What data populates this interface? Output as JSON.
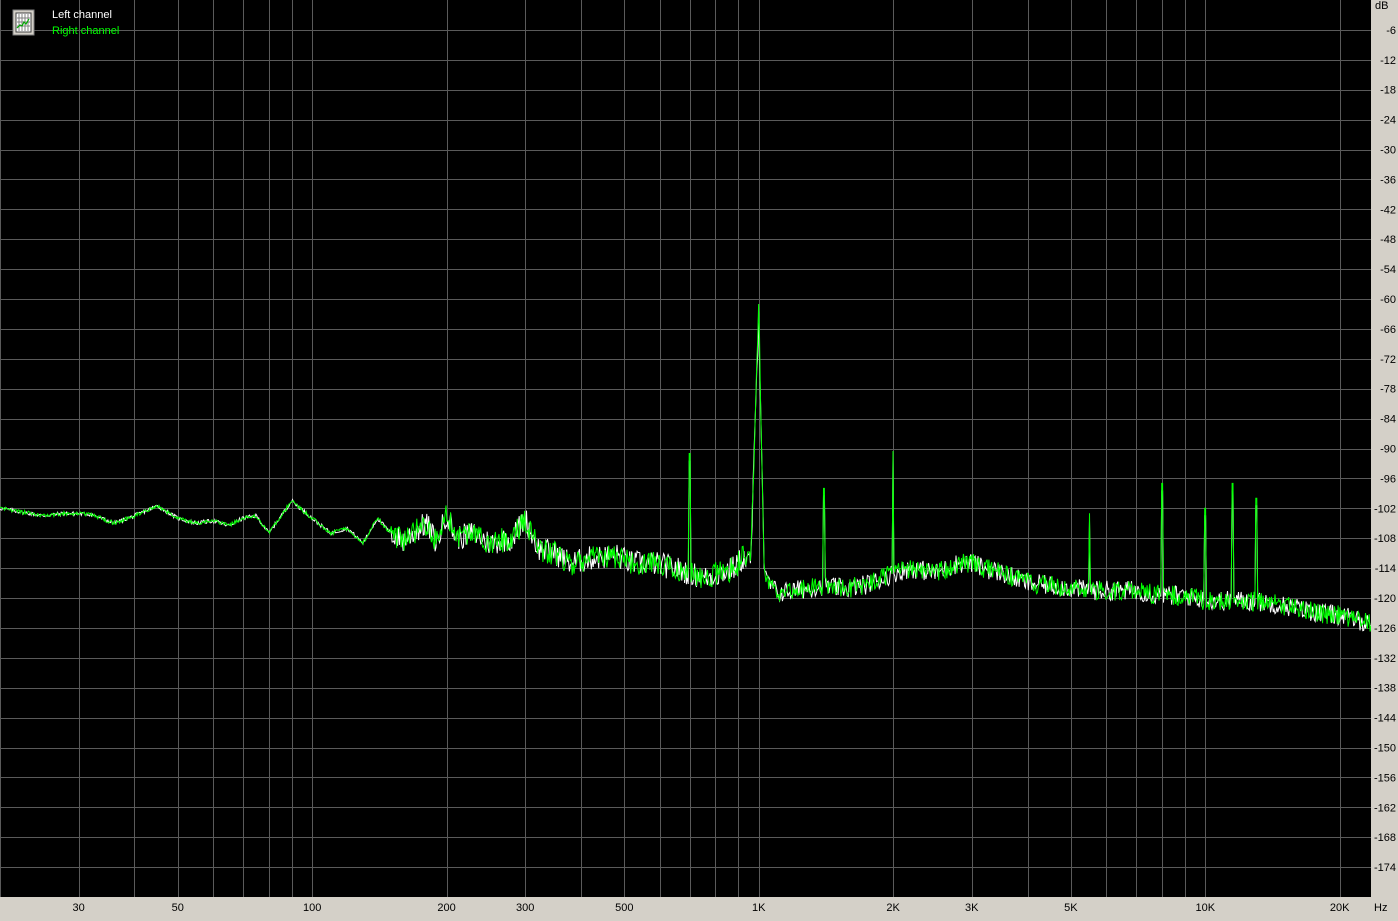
{
  "legend": {
    "icon": "spectrum-legend-icon",
    "items": [
      {
        "label": "Left channel",
        "color": "#ffffff"
      },
      {
        "label": "Right channel",
        "color": "#00ff00"
      }
    ]
  },
  "colors": {
    "background": "#000000",
    "grid": "#5a5a5a",
    "left_channel": "#ffffff",
    "right_channel": "#00ff00",
    "axis_panel": "#d4d0c8"
  },
  "chart_data": {
    "type": "line",
    "xscale": "log",
    "xlim": [
      20,
      23500
    ],
    "ylim": [
      -180,
      0
    ],
    "yunit": "dB",
    "xunit": "Hz",
    "grid": true,
    "legend_position": "top-left",
    "yticks": [
      -6,
      -12,
      -18,
      -24,
      -30,
      -36,
      -42,
      -48,
      -54,
      -60,
      -66,
      -72,
      -78,
      -84,
      -90,
      -96,
      -102,
      -108,
      -114,
      -120,
      -126,
      -132,
      -138,
      -144,
      -150,
      -156,
      -162,
      -168,
      -174
    ],
    "xticks": [
      {
        "value": 30,
        "label": "30"
      },
      {
        "value": 50,
        "label": "50"
      },
      {
        "value": 100,
        "label": "100"
      },
      {
        "value": 200,
        "label": "200"
      },
      {
        "value": 300,
        "label": "300"
      },
      {
        "value": 500,
        "label": "500"
      },
      {
        "value": 1000,
        "label": "1K"
      },
      {
        "value": 2000,
        "label": "2K"
      },
      {
        "value": 3000,
        "label": "3K"
      },
      {
        "value": 5000,
        "label": "5K"
      },
      {
        "value": 10000,
        "label": "10K"
      },
      {
        "value": 20000,
        "label": "20K"
      }
    ],
    "series": [
      {
        "name": "Left channel",
        "color": "#ffffff",
        "points": [
          [
            20,
            -102
          ],
          [
            25,
            -103.5
          ],
          [
            28,
            -103
          ],
          [
            32,
            -103.2
          ],
          [
            36,
            -105
          ],
          [
            40,
            -103.5
          ],
          [
            45,
            -101.5
          ],
          [
            50,
            -104
          ],
          [
            55,
            -105
          ],
          [
            60,
            -104.5
          ],
          [
            65,
            -105.5
          ],
          [
            70,
            -104
          ],
          [
            75,
            -103.5
          ],
          [
            80,
            -107
          ],
          [
            90,
            -100.5
          ],
          [
            100,
            -104
          ],
          [
            110,
            -107
          ],
          [
            120,
            -106
          ],
          [
            130,
            -109
          ],
          [
            140,
            -104
          ],
          [
            150,
            -107
          ],
          [
            160,
            -108.5
          ],
          [
            180,
            -105
          ],
          [
            190,
            -109
          ],
          [
            200,
            -103
          ],
          [
            210,
            -108
          ],
          [
            230,
            -107
          ],
          [
            250,
            -109
          ],
          [
            280,
            -108
          ],
          [
            300,
            -104
          ],
          [
            320,
            -110
          ],
          [
            350,
            -111
          ],
          [
            380,
            -113
          ],
          [
            420,
            -112
          ],
          [
            480,
            -111.5
          ],
          [
            520,
            -113
          ],
          [
            580,
            -113
          ],
          [
            650,
            -114
          ],
          [
            700,
            -115
          ],
          [
            760,
            -116
          ],
          [
            820,
            -115
          ],
          [
            880,
            -114
          ],
          [
            920,
            -112
          ],
          [
            960,
            -113
          ],
          [
            1000,
            -63
          ],
          [
            1030,
            -116
          ],
          [
            1100,
            -119
          ],
          [
            1200,
            -118.5
          ],
          [
            1300,
            -118
          ],
          [
            1400,
            -117.5
          ],
          [
            1500,
            -118
          ],
          [
            1600,
            -118
          ],
          [
            1800,
            -117
          ],
          [
            2000,
            -115
          ],
          [
            2200,
            -114
          ],
          [
            2500,
            -115
          ],
          [
            2800,
            -113
          ],
          [
            3000,
            -113
          ],
          [
            3200,
            -114
          ],
          [
            3500,
            -115
          ],
          [
            4000,
            -117
          ],
          [
            4500,
            -117.5
          ],
          [
            5000,
            -118
          ],
          [
            5500,
            -118.5
          ],
          [
            6000,
            -118.5
          ],
          [
            6500,
            -118.5
          ],
          [
            7000,
            -118.5
          ],
          [
            8000,
            -119.5
          ],
          [
            9000,
            -119.5
          ],
          [
            10000,
            -120.5
          ],
          [
            11000,
            -120.5
          ],
          [
            12000,
            -120.5
          ],
          [
            14000,
            -121
          ],
          [
            16000,
            -122
          ],
          [
            18000,
            -123
          ],
          [
            20000,
            -123.5
          ],
          [
            22000,
            -124.5
          ],
          [
            23500,
            -125
          ]
        ]
      },
      {
        "name": "Right channel",
        "color": "#00ff00",
        "points": [
          [
            20,
            -102
          ],
          [
            25,
            -103.5
          ],
          [
            28,
            -103
          ],
          [
            32,
            -103.2
          ],
          [
            36,
            -105
          ],
          [
            40,
            -103.5
          ],
          [
            45,
            -101.5
          ],
          [
            50,
            -104
          ],
          [
            55,
            -105
          ],
          [
            60,
            -104.5
          ],
          [
            65,
            -105.5
          ],
          [
            70,
            -104
          ],
          [
            75,
            -103.5
          ],
          [
            80,
            -107
          ],
          [
            90,
            -100.5
          ],
          [
            100,
            -104
          ],
          [
            110,
            -107
          ],
          [
            120,
            -106
          ],
          [
            130,
            -109
          ],
          [
            140,
            -104
          ],
          [
            150,
            -107
          ],
          [
            160,
            -108.5
          ],
          [
            180,
            -105
          ],
          [
            190,
            -109
          ],
          [
            200,
            -103
          ],
          [
            210,
            -108
          ],
          [
            230,
            -107
          ],
          [
            250,
            -109
          ],
          [
            280,
            -108
          ],
          [
            300,
            -104
          ],
          [
            320,
            -110
          ],
          [
            350,
            -111
          ],
          [
            380,
            -113
          ],
          [
            420,
            -112
          ],
          [
            480,
            -111.5
          ],
          [
            520,
            -113
          ],
          [
            580,
            -113
          ],
          [
            650,
            -114
          ],
          [
            700,
            -115
          ],
          [
            760,
            -116
          ],
          [
            820,
            -115
          ],
          [
            880,
            -114
          ],
          [
            920,
            -112
          ],
          [
            960,
            -113
          ],
          [
            1000,
            -61
          ],
          [
            1030,
            -116
          ],
          [
            1100,
            -119
          ],
          [
            1200,
            -118.5
          ],
          [
            1300,
            -118
          ],
          [
            1400,
            -117.5
          ],
          [
            1500,
            -118
          ],
          [
            1600,
            -118
          ],
          [
            1800,
            -117
          ],
          [
            2000,
            -115
          ],
          [
            2200,
            -114
          ],
          [
            2500,
            -115
          ],
          [
            2800,
            -113
          ],
          [
            3000,
            -113
          ],
          [
            3200,
            -114
          ],
          [
            3500,
            -115
          ],
          [
            4000,
            -117
          ],
          [
            4500,
            -117.5
          ],
          [
            5000,
            -118
          ],
          [
            5500,
            -118.5
          ],
          [
            6000,
            -118.5
          ],
          [
            6500,
            -118.5
          ],
          [
            7000,
            -118.5
          ],
          [
            8000,
            -119.5
          ],
          [
            9000,
            -119.5
          ],
          [
            10000,
            -120.5
          ],
          [
            11000,
            -120.5
          ],
          [
            12000,
            -120.5
          ],
          [
            14000,
            -121
          ],
          [
            16000,
            -122
          ],
          [
            18000,
            -123
          ],
          [
            20000,
            -123.5
          ],
          [
            22000,
            -124.5
          ],
          [
            23500,
            -125
          ]
        ]
      }
    ],
    "spikes": [
      {
        "x": 700,
        "y": -91
      },
      {
        "x": 1000,
        "y": -61
      },
      {
        "x": 1400,
        "y": -98
      },
      {
        "x": 2000,
        "y": -90.5
      },
      {
        "x": 5500,
        "y": -103
      },
      {
        "x": 8000,
        "y": -97
      },
      {
        "x": 10000,
        "y": -102
      },
      {
        "x": 11500,
        "y": -97
      },
      {
        "x": 13000,
        "y": -100
      }
    ]
  },
  "axes": {
    "y_unit_label": "dB",
    "x_unit_label": "Hz"
  }
}
